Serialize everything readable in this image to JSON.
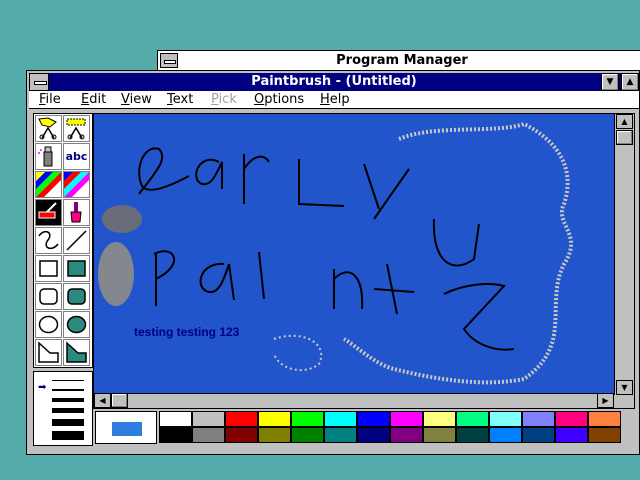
{
  "program_manager": {
    "title": "Program Manager"
  },
  "paintbrush": {
    "title": "Paintbrush - (Untitled)",
    "menu": [
      {
        "label": "File",
        "disabled": false
      },
      {
        "label": "Edit",
        "disabled": false
      },
      {
        "label": "View",
        "disabled": false
      },
      {
        "label": "Text",
        "disabled": false
      },
      {
        "label": "Pick",
        "disabled": true
      },
      {
        "label": "Options",
        "disabled": false
      },
      {
        "label": "Help",
        "disabled": false
      }
    ],
    "tools": [
      {
        "icon": "scissors-icon",
        "name": "tool-scissors"
      },
      {
        "icon": "pick-scissors-icon",
        "name": "tool-pick"
      },
      {
        "icon": "airbrush-icon",
        "name": "tool-airbrush"
      },
      {
        "icon": "text-icon",
        "label": "abc",
        "name": "tool-text"
      },
      {
        "icon": "color-eraser-icon",
        "name": "tool-color-eraser"
      },
      {
        "icon": "eraser-icon",
        "name": "tool-eraser"
      },
      {
        "icon": "paint-roller-icon",
        "name": "tool-paint-roller"
      },
      {
        "icon": "brush-icon",
        "name": "tool-brush"
      },
      {
        "icon": "curve-icon",
        "name": "tool-curve"
      },
      {
        "icon": "line-icon",
        "name": "tool-line"
      },
      {
        "icon": "box-icon",
        "name": "tool-box"
      },
      {
        "icon": "filled-box-icon",
        "name": "tool-filled-box"
      },
      {
        "icon": "rounded-box-icon",
        "name": "tool-rounded-box"
      },
      {
        "icon": "filled-rounded-box-icon",
        "name": "tool-filled-rounded-box"
      },
      {
        "icon": "circle-icon",
        "name": "tool-circle"
      },
      {
        "icon": "filled-circle-icon",
        "name": "tool-filled-circle"
      },
      {
        "icon": "polygon-icon",
        "name": "tool-polygon"
      },
      {
        "icon": "filled-polygon-icon",
        "name": "tool-filled-polygon"
      }
    ],
    "canvas": {
      "background": "#2255cc",
      "text": "testing testing 123"
    },
    "colors": {
      "foreground": "#2e7ee0",
      "background": "#ffffff",
      "palette": [
        "#ffffff",
        "#c0c0c0",
        "#ff0000",
        "#ffff00",
        "#00ff00",
        "#00ffff",
        "#0000ff",
        "#ff00ff",
        "#ffff80",
        "#00ff80",
        "#80ffff",
        "#8080ff",
        "#ff0080",
        "#ff8040",
        "#000000",
        "#808080",
        "#800000",
        "#808000",
        "#008000",
        "#008080",
        "#000080",
        "#800080",
        "#808040",
        "#004040",
        "#0080ff",
        "#004080",
        "#4000ff",
        "#804000"
      ]
    }
  }
}
